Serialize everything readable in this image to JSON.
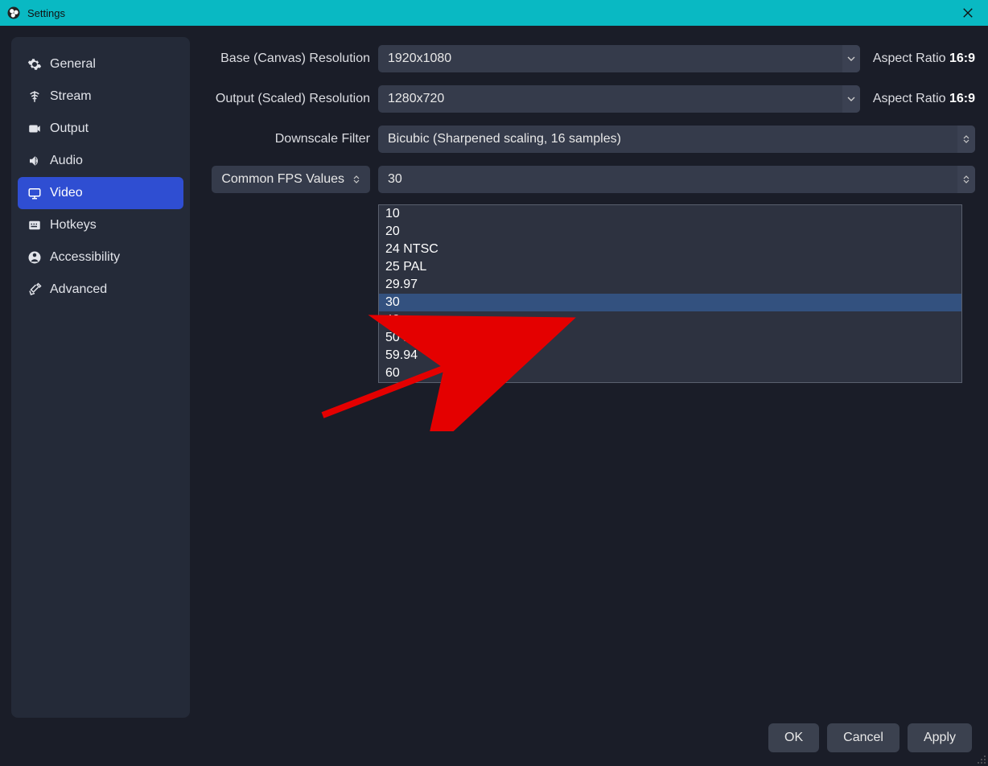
{
  "window": {
    "title": "Settings"
  },
  "sidebar": {
    "items": [
      {
        "label": "General"
      },
      {
        "label": "Stream"
      },
      {
        "label": "Output"
      },
      {
        "label": "Audio"
      },
      {
        "label": "Video"
      },
      {
        "label": "Hotkeys"
      },
      {
        "label": "Accessibility"
      },
      {
        "label": "Advanced"
      }
    ],
    "active_index": 4
  },
  "video": {
    "base_label": "Base (Canvas) Resolution",
    "base_value": "1920x1080",
    "base_aspect_prefix": "Aspect Ratio ",
    "base_aspect_value": "16:9",
    "output_label": "Output (Scaled) Resolution",
    "output_value": "1280x720",
    "output_aspect_prefix": "Aspect Ratio ",
    "output_aspect_value": "16:9",
    "filter_label": "Downscale Filter",
    "filter_value": "Bicubic (Sharpened scaling, 16 samples)",
    "fps_type_label": "Common FPS Values",
    "fps_value": "30",
    "fps_options": [
      "10",
      "20",
      "24 NTSC",
      "25 PAL",
      "29.97",
      "30",
      "48",
      "50 PAL",
      "59.94",
      "60"
    ],
    "fps_selected_index": 5
  },
  "footer": {
    "ok": "OK",
    "cancel": "Cancel",
    "apply": "Apply"
  }
}
